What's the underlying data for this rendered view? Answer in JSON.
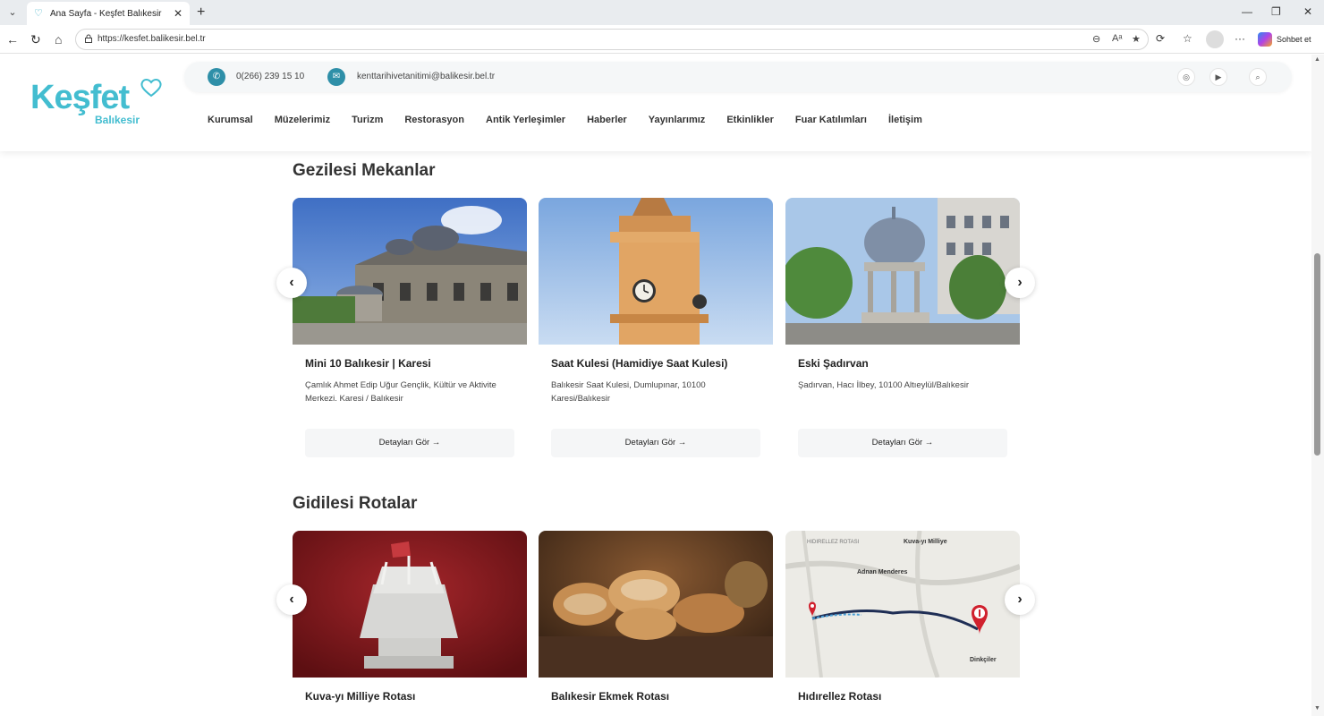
{
  "browser": {
    "tab_title": "Ana Sayfa - Keşfet Balıkesir",
    "url": "https://kesfet.balikesir.bel.tr",
    "copilot_label": "Sohbet et"
  },
  "site": {
    "logo_text": "Keşfet",
    "logo_sub": "Balıkesir",
    "phone": "0(266) 239 15 10",
    "email": "kenttarihivetanitimi@balikesir.bel.tr",
    "menu": [
      "Kurumsal",
      "Müzelerimiz",
      "Turizm",
      "Restorasyon",
      "Antik Yerleşimler",
      "Haberler",
      "Yayınlarımız",
      "Etkinlikler",
      "Fuar Katılımları",
      "İletişim"
    ]
  },
  "places": {
    "title": "Gezilesi Mekanlar",
    "cards": [
      {
        "name": "Mini 10 Balıkesir | Karesi",
        "addr": "Çamlık Ahmet Edip Uğur Gençlik, Kültür ve Aktivite Merkezi. Karesi / Balıkesir",
        "btn": "Detayları Gör →"
      },
      {
        "name": "Saat Kulesi (Hamidiye Saat Kulesi)",
        "addr": "Balıkesir Saat Kulesi, Dumlupınar, 10100 Karesi/Balıkesir",
        "btn": "Detayları Gör →"
      },
      {
        "name": "Eski Şadırvan",
        "addr": "Şadırvan, Hacı İlbey, 10100 Altıeylül/Balıkesir",
        "btn": "Detayları Gör →"
      }
    ]
  },
  "routes": {
    "title": "Gidilesi Rotalar",
    "cards": [
      {
        "name": "Kuva-yı Milliye Rotası"
      },
      {
        "name": "Balıkesir Ekmek Rotası"
      },
      {
        "name": "Hıdırellez Rotası"
      }
    ],
    "map_labels": {
      "kuvayi": "Kuva-yı Milliye",
      "adnan": "Adnan Menderes",
      "dinkciler": "Dinkçiler",
      "title": "HIDIRELLEZ ROTASI"
    }
  },
  "colors": {
    "brand": "#43bdd0",
    "icon_bg": "#2e8fa8",
    "pin": "#d0212e"
  }
}
